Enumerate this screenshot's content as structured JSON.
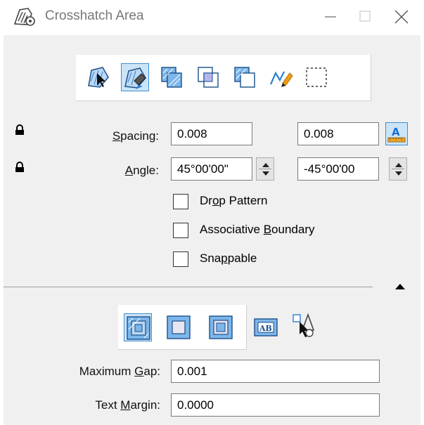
{
  "window": {
    "title": "Crosshatch Area",
    "minimize_label": "—",
    "close_label": "✕"
  },
  "toolbar1": {
    "tools": [
      {
        "name": "element-mode-tool",
        "selected": false
      },
      {
        "name": "flood-mode-tool",
        "selected": true
      },
      {
        "name": "union-mode-tool",
        "selected": false
      },
      {
        "name": "intersection-mode-tool",
        "selected": false
      },
      {
        "name": "difference-mode-tool",
        "selected": false
      },
      {
        "name": "points-mode-tool",
        "selected": false
      },
      {
        "name": "fence-mode-tool",
        "selected": false
      }
    ]
  },
  "spacing": {
    "label_pre": "",
    "label_u": "S",
    "label_post": "pacing:",
    "value1": "0.008",
    "value2": "0.008",
    "annotation_icon": "annotation-scale-icon",
    "locked": true
  },
  "angle": {
    "label_pre": "",
    "label_u": "A",
    "label_post": "ngle:",
    "value1": "45°00'00\"",
    "value2": "-45°00'00",
    "locked": true
  },
  "options": [
    {
      "pre": "Dr",
      "u": "o",
      "post": "p Pattern",
      "checked": false
    },
    {
      "pre": "Associative ",
      "u": "B",
      "post": "oundary",
      "checked": false
    },
    {
      "pre": "Sna",
      "u": "p",
      "post": "pable",
      "checked": false
    }
  ],
  "toolbar2": {
    "tools": [
      {
        "name": "outer-inner-tool",
        "selected": true
      },
      {
        "name": "outer-tool",
        "selected": false
      },
      {
        "name": "alternating-tool",
        "selected": false
      },
      {
        "name": "text-tool",
        "selected": false
      },
      {
        "name": "locate-interior-tool",
        "selected": false
      }
    ]
  },
  "max_gap": {
    "label_pre": "Maximum ",
    "label_u": "G",
    "label_post": "ap:",
    "value": "0.001"
  },
  "text_margin": {
    "label_pre": "Text ",
    "label_u": "M",
    "label_post": "argin:",
    "value": "0.0000"
  },
  "colors": {
    "window_bg": "#f0f0f0",
    "selected_tool_bg": "#cce4f7",
    "selected_tool_border": "#3d8fd1",
    "hatch_blue": "#2a7fd4"
  }
}
